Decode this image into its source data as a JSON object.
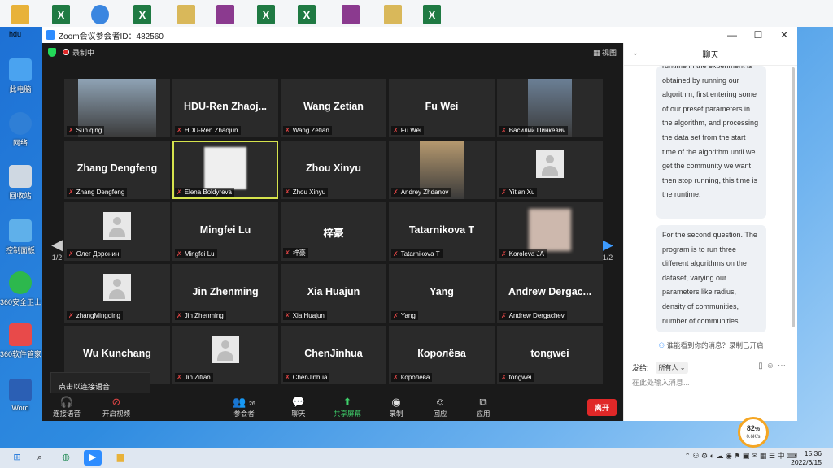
{
  "desktop": {
    "top_icons": [
      "hdu-folder",
      "excel",
      "browser",
      "excel",
      "archive",
      "archive",
      "excel",
      "excel",
      "archive",
      "archive",
      "excel"
    ],
    "left_icons": [
      {
        "label": "hdu",
        "icon": "folder-icon"
      },
      {
        "label": "此电脑",
        "icon": "computer-icon"
      },
      {
        "label": "网络",
        "icon": "network-icon"
      },
      {
        "label": "回收站",
        "icon": "recycle-bin-icon"
      },
      {
        "label": "控制面板",
        "icon": "control-panel-icon"
      },
      {
        "label": "360安全卫士",
        "icon": "360-security-icon"
      },
      {
        "label": "360软件管家",
        "icon": "360-software-icon"
      },
      {
        "label": "Word",
        "icon": "word-icon"
      }
    ]
  },
  "window": {
    "title": "Zoom会议参会者ID：482560",
    "controls": [
      "—",
      "☐",
      "✕"
    ]
  },
  "meeting": {
    "recording_label": "录制中",
    "view_label": "视图",
    "page_indicator_left": "1/2",
    "page_indicator_right": "1/2",
    "tooltip": "点击以连接语音",
    "participants": [
      {
        "big": "",
        "name": "Sun qing",
        "kind": "photo"
      },
      {
        "big": "HDU-Ren Zhaoj...",
        "name": "HDU-Ren Zhaojun",
        "kind": "name"
      },
      {
        "big": "Wang Zetian",
        "name": "Wang Zetian",
        "kind": "name"
      },
      {
        "big": "Fu Wei",
        "name": "Fu Wei",
        "kind": "name"
      },
      {
        "big": "",
        "name": "Василий Пинкевич",
        "kind": "photo"
      },
      {
        "big": "Zhang Dengfeng",
        "name": "Zhang Dengfeng",
        "kind": "name"
      },
      {
        "big": "",
        "name": "Elena Boldyreva",
        "kind": "blank",
        "active": true
      },
      {
        "big": "Zhou Xinyu",
        "name": "Zhou Xinyu",
        "kind": "name"
      },
      {
        "big": "",
        "name": "Andrey Zhdanov",
        "kind": "photo"
      },
      {
        "big": "",
        "name": "Yitian Xu",
        "kind": "avatar"
      },
      {
        "big": "",
        "name": "Олег Доронин",
        "kind": "avatar"
      },
      {
        "big": "Mingfei Lu",
        "name": "Mingfei Lu",
        "kind": "name"
      },
      {
        "big": "梓豪",
        "name": "梓豪",
        "kind": "name"
      },
      {
        "big": "Tatarnikova T",
        "name": "Tatarnikova T",
        "kind": "name"
      },
      {
        "big": "",
        "name": "Koroleva JA",
        "kind": "blur"
      },
      {
        "big": "",
        "name": "zhangMingqing",
        "kind": "avatar"
      },
      {
        "big": "Jin Zhenming",
        "name": "Jin Zhenming",
        "kind": "name"
      },
      {
        "big": "Xia Huajun",
        "name": "Xia Huajun",
        "kind": "name"
      },
      {
        "big": "Yang",
        "name": "Yang",
        "kind": "name"
      },
      {
        "big": "Andrew Dergac...",
        "name": "Andrew Dergachev",
        "kind": "name"
      },
      {
        "big": "Wu Kunchang",
        "name": "",
        "kind": "name"
      },
      {
        "big": "",
        "name": "Jin Zitian",
        "kind": "avatar"
      },
      {
        "big": "ChenJinhua",
        "name": "ChenJinhua",
        "kind": "name"
      },
      {
        "big": "Королёва",
        "name": "Королёва",
        "kind": "name"
      },
      {
        "big": "tongwei",
        "name": "tongwei",
        "kind": "name"
      }
    ]
  },
  "toolbar": {
    "audio": "连接语音",
    "video": "开启视频",
    "participants": "参会者",
    "participants_count": "26",
    "chat": "聊天",
    "share": "共享屏幕",
    "record": "录制",
    "reactions": "回应",
    "apps": "应用",
    "leave": "离开"
  },
  "chat": {
    "title": "聊天",
    "messages": [
      "runtime in the experiment is obtained by running our algorithm, first entering some of our preset parameters in the algorithm, and processing the data set from the start time of the algorithm until we get the community we want then stop running, this time is the runtime.",
      "For the second question. The program is to run three different algorithms on the dataset, varying our parameters like radius, density of communities, number of communities."
    ],
    "privacy": "谁能看到你的消息？录制已开启",
    "send_to_label": "发给:",
    "send_to_value": "所有人",
    "input_placeholder": "在此处输入消息..."
  },
  "perf": {
    "percent": "82",
    "unit": "%",
    "net": "0.6K/s"
  },
  "taskbar": {
    "time": "15:36",
    "date": "2022/6/15"
  }
}
